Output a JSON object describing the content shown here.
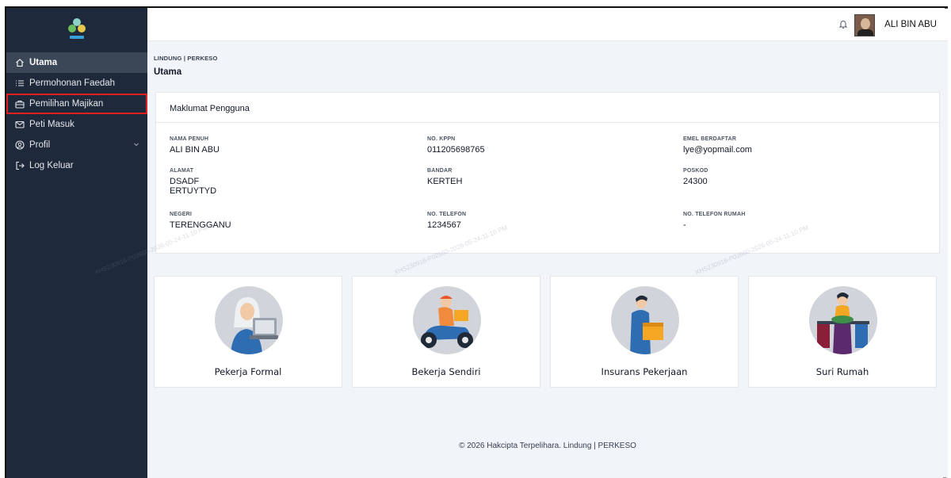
{
  "sidebar": {
    "items": [
      {
        "label": "Utama",
        "icon": "home-icon"
      },
      {
        "label": "Permohonan Faedah",
        "icon": "list-icon"
      },
      {
        "label": "Pemilihan Majikan",
        "icon": "briefcase-icon"
      },
      {
        "label": "Peti Masuk",
        "icon": "mail-icon"
      },
      {
        "label": "Profil",
        "icon": "user-circle-icon"
      },
      {
        "label": "Log Keluar",
        "icon": "logout-icon"
      }
    ]
  },
  "topbar": {
    "username": "ALI BIN ABU"
  },
  "breadcrumb": "LINDUNG | PERKESO",
  "page_title": "Utama",
  "profile_card": {
    "title": "Maklumat Pengguna",
    "fields": {
      "nama_penuh": {
        "label": "NAMA PENUH",
        "value": "ALI BIN ABU"
      },
      "no_kppn": {
        "label": "NO. KPPN",
        "value": "011205698765"
      },
      "emel": {
        "label": "EMEL BERDAFTAR",
        "value": "lye@yopmail.com"
      },
      "alamat": {
        "label": "ALAMAT",
        "value": "DSADF\nERTUYTYD"
      },
      "bandar": {
        "label": "BANDAR",
        "value": "KERTEH"
      },
      "poskod": {
        "label": "POSKOD",
        "value": "24300"
      },
      "negeri": {
        "label": "NEGERI",
        "value": "TERENGGANU"
      },
      "no_telefon": {
        "label": "NO. TELEFON",
        "value": "1234567"
      },
      "no_telefon_rumah": {
        "label": "NO. TELEFON RUMAH",
        "value": "-"
      }
    }
  },
  "watermark": "XHS230916-P02660-2026-05-24-11:10 PM",
  "tiles": [
    {
      "label": "Pekerja Formal"
    },
    {
      "label": "Bekerja Sendiri"
    },
    {
      "label": "Insurans Pekerjaan"
    },
    {
      "label": "Suri Rumah"
    }
  ],
  "footer": "© 2026 Hakcipta Terpelihara. Lindung | PERKESO",
  "colors": {
    "sidebar_bg": "#1e2a3b",
    "active_bg": "#3b4657",
    "highlight": "#e02020",
    "page_bg": "#f1f4f8"
  }
}
